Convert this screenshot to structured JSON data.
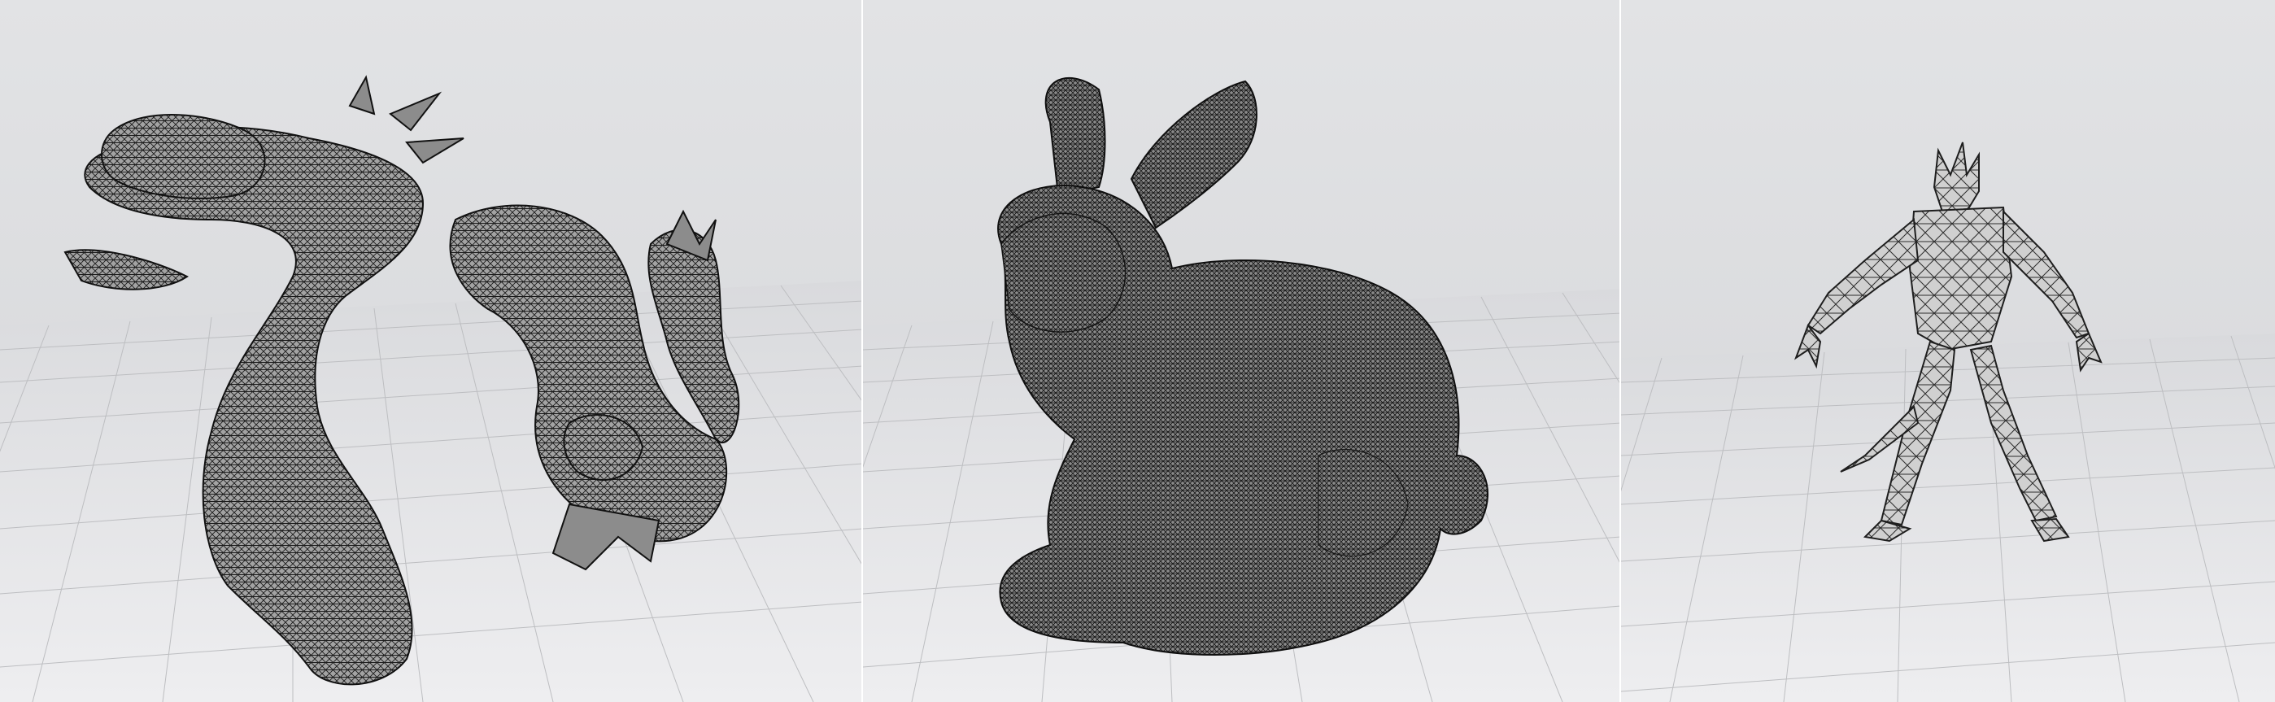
{
  "figure": {
    "panels": [
      {
        "subject": "dragon",
        "mesh_density": "dense",
        "background_color": "#dddee0",
        "floor_color": "#e6e6e8",
        "grid_line_color": "#b9babd",
        "mesh_fill": "#a9a9a9",
        "wire_color": "#1a1a1a"
      },
      {
        "subject": "bunny",
        "mesh_density": "very-dense",
        "background_color": "#dddee0",
        "floor_color": "#e6e6e8",
        "grid_line_color": "#b9babd",
        "mesh_fill": "#8f8f8f",
        "wire_color": "#111111"
      },
      {
        "subject": "monster-figure",
        "mesh_density": "coarse",
        "background_color": "#dddee0",
        "floor_color": "#e6e6e8",
        "grid_line_color": "#b9babd",
        "mesh_fill": "#d3d3d3",
        "wire_color": "#2a2a2a"
      }
    ]
  }
}
